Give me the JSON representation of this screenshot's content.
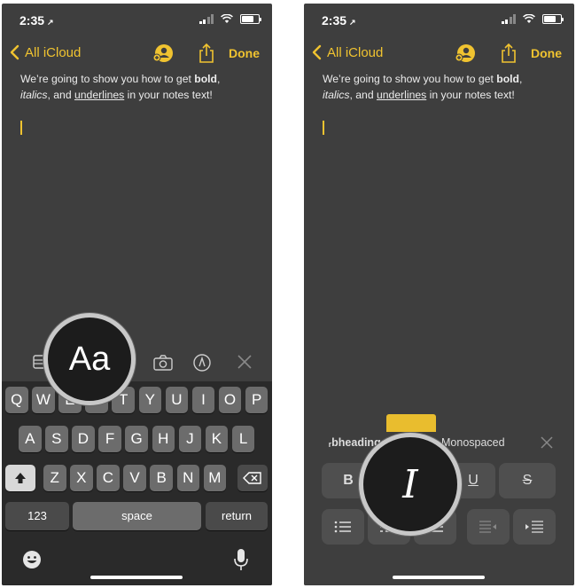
{
  "status": {
    "time": "2:35",
    "location_arrow": "↗"
  },
  "nav": {
    "back_label": "All iCloud",
    "done_label": "Done"
  },
  "note": {
    "line1_prefix": "We’re going to show you how to get ",
    "bold_word": "bold",
    "line1_suffix": ",",
    "italic_word": "italics",
    "mid": ", and ",
    "underline_word": "underlines",
    "line2_suffix": " in your notes text!"
  },
  "keyboard": {
    "row1": [
      "Q",
      "W",
      "E",
      "R",
      "T",
      "Y",
      "U",
      "I",
      "O",
      "P"
    ],
    "row2": [
      "A",
      "S",
      "D",
      "F",
      "G",
      "H",
      "J",
      "K",
      "L"
    ],
    "row3": [
      "Z",
      "X",
      "C",
      "V",
      "B",
      "N",
      "M"
    ],
    "numbers_label": "123",
    "space_label": "space",
    "return_label": "return"
  },
  "magnifier_left": {
    "label": "Aa"
  },
  "magnifier_right": {
    "label": "I"
  },
  "format": {
    "style_left": "ᵣbheading",
    "style_right": "Monospaced",
    "bold_label": "B",
    "underline_label": "U",
    "strike_label": "S"
  },
  "colors": {
    "accent": "#f0c330",
    "background": "#3e3e3e"
  }
}
